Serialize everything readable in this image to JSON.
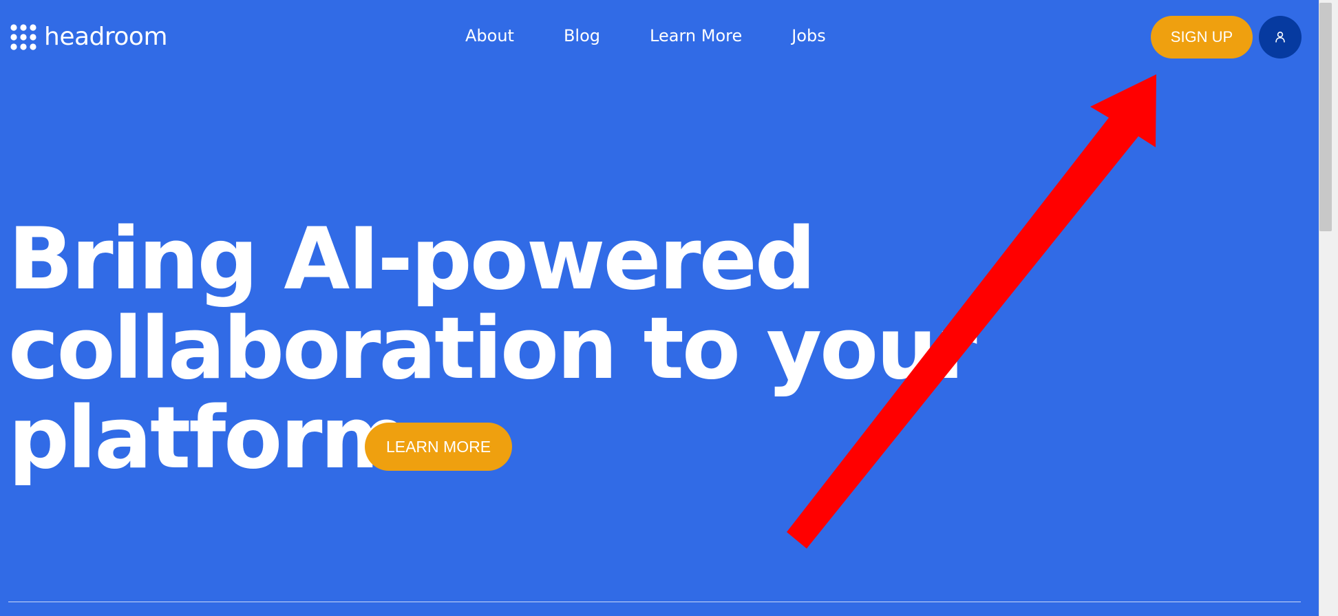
{
  "header": {
    "logo_text": "headroom",
    "nav": [
      {
        "label": "About"
      },
      {
        "label": "Blog"
      },
      {
        "label": "Learn More"
      },
      {
        "label": "Jobs"
      }
    ],
    "signup_label": "SIGN UP",
    "account_icon": "user-icon"
  },
  "hero": {
    "headline_lines": [
      "Bring AI-powered",
      "collaboration to your",
      "platform"
    ],
    "cta_label": "LEARN MORE"
  },
  "colors": {
    "background": "#316be6",
    "accent": "#efa00f",
    "account_button": "#063aa0",
    "annotation_arrow": "#ff0000",
    "text": "#ffffff"
  }
}
